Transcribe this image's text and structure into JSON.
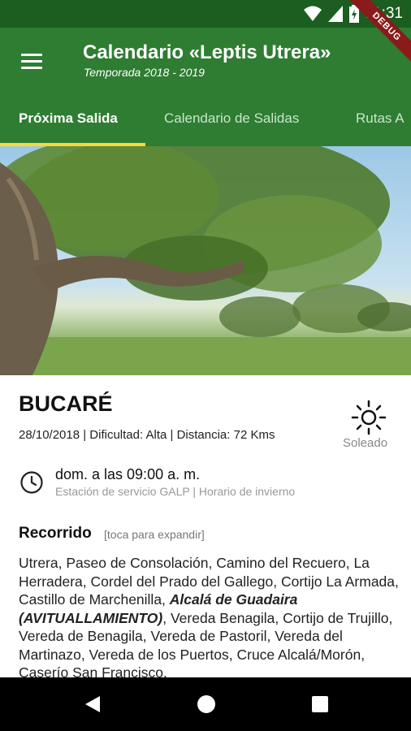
{
  "status_bar": {
    "time": "11:31",
    "debug_label": "DEBUG"
  },
  "app_bar": {
    "title": "Calendario «Leptis Utrera»",
    "subtitle": "Temporada 2018 - 2019"
  },
  "tabs": [
    {
      "label": "Próxima Salida"
    },
    {
      "label": "Calendario de Salidas"
    },
    {
      "label": "Rutas A"
    }
  ],
  "hero_image": {
    "description_icon": "photo-landscape"
  },
  "route": {
    "name": "BUCARÉ",
    "meta": "28/10/2018 | Dificultad: Alta | Distancia: 72 Kms",
    "weather": "Soleado",
    "time_main": "dom. a las 09:00 a. m.",
    "time_sub": "Estación de servicio GALP | Horario de invierno"
  },
  "recorrido": {
    "title": "Recorrido",
    "hint": "[toca para expandir]",
    "text_before": "Utrera, Paseo de Consolación, Camino del Recuero, La Herradera, Cordel del Prado del Gallego, Cortijo La Armada, Castillo de Marchenilla, ",
    "text_bold": "Alcalá de Guadaira (AVITUALLAMIENTO)",
    "text_after": ", Vereda Benagila, Cortijo de Trujillo, Vereda de Benagila, Vereda de Pastoril, Vereda del Martinazo, Vereda de los Puertos, Cruce Alcalá/Morón, Caserío San Francisco,"
  },
  "colors": {
    "primary": "#2e7d32",
    "primary_dark": "#1b5e20",
    "tab_indicator": "#fdd835"
  }
}
